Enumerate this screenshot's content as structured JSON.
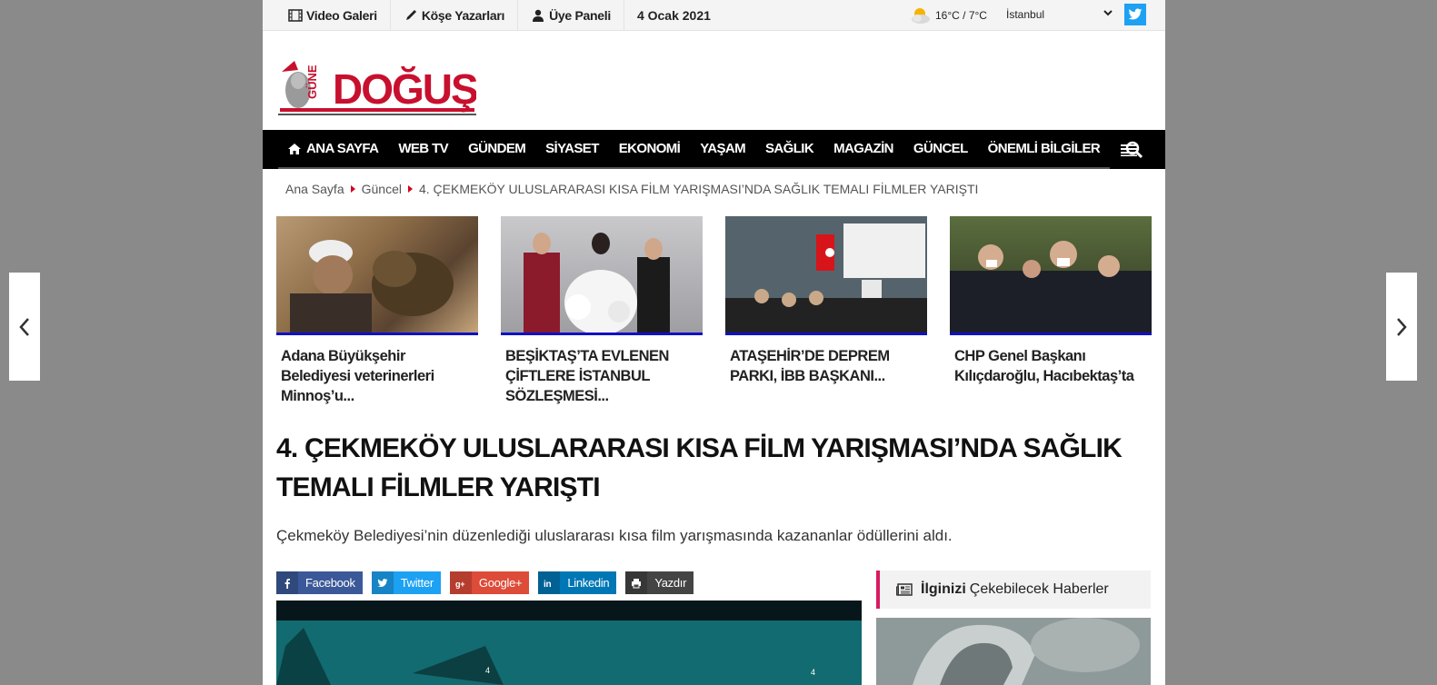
{
  "topbar": {
    "video": "Video Galeri",
    "writers": "Köşe Yazarları",
    "member": "Üye Paneli",
    "date": "4 Ocak 2021",
    "temp": "16°C / 7°C",
    "city": "İstanbul"
  },
  "nav": [
    "ANA SAYFA",
    "WEB TV",
    "GÜNDEM",
    "SİYASET",
    "EKONOMİ",
    "YAŞAM",
    "SAĞLIK",
    "MAGAZİN",
    "GÜNCEL",
    "ÖNEMLİ BİLGİLER"
  ],
  "breadcrumb": {
    "home": "Ana Sayfa",
    "category": "Güncel",
    "current": "4. ÇEKMEKÖY ULUSLARARASI KISA FİLM YARIŞMASI’NDA SAĞLIK TEMALI FİLMLER YARIŞTI"
  },
  "cards": [
    {
      "title": "Adana Büyükşehir Belediyesi veterinerleri Minnoş’u..."
    },
    {
      "title": "BEŞİKTAŞ’TA EVLENEN ÇİFTLERE İSTANBUL SÖZLEŞMESİ..."
    },
    {
      "title": "ATAŞEHİR’DE DEPREM PARKI, İBB BAŞKANI..."
    },
    {
      "title": "CHP Genel Başkanı Kılıçdaroğlu, Hacıbektaş’ta"
    }
  ],
  "article": {
    "headline": "4. ÇEKMEKÖY ULUSLARARASI KISA FİLM YARIŞMASI’NDA SAĞLIK TEMALI FİLMLER YARIŞTI",
    "summary": "Çekmeköy Belediyesi’nin düzenlediği uluslararası kısa film yarışmasında kazananlar ödüllerini aldı."
  },
  "share": {
    "facebook": "Facebook",
    "twitter": "Twitter",
    "google": "Google+",
    "linkedin": "Linkedin",
    "print": "Yazdır"
  },
  "sidebar": {
    "heading_bold": "İlginizi",
    "heading_rest": "Çekebilecek Haberler"
  },
  "colors": {
    "facebook": "#3b5998",
    "twitter": "#1da1f2",
    "google": "#dd4b39",
    "linkedin": "#0077b5",
    "print": "#444444",
    "accent": "#d81b60",
    "card_border": "#1010c8"
  }
}
